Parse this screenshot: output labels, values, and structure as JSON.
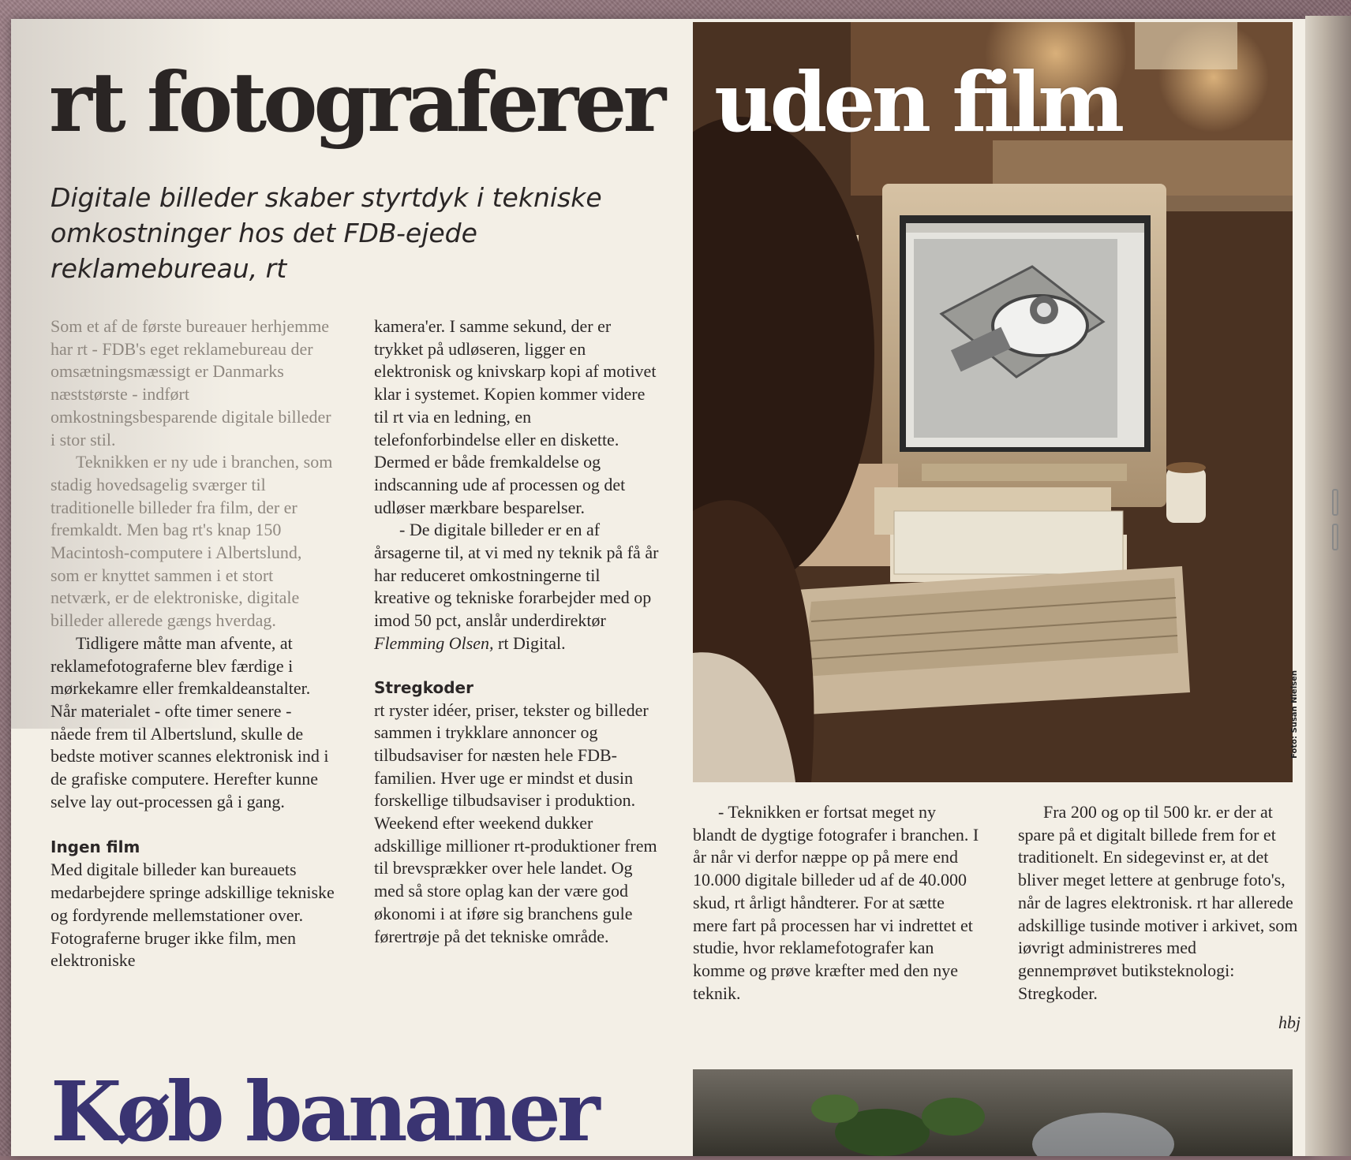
{
  "article": {
    "headline_dark": "rt fotograferer",
    "headline_light": "uden film",
    "subtitle": "Digitale billeder skaber styrtdyk i tekniske omkostninger hos det FDB-ejede reklamebureau, rt",
    "col1": {
      "p1": "Som et af de første bureauer herhjemme har rt - FDB's eget reklamebureau der omsætningsmæssigt er Danmarks næststørste - indført omkostningsbesparende digitale billeder i stor stil.",
      "p2": "Teknikken er ny ude i branchen, som stadig hovedsagelig sværger til traditionelle billeder fra film, der er fremkaldt. Men bag rt's knap 150 Macintosh-computere i Albertslund, som er knyttet sammen i et stort netværk, er de elektroniske, digitale billeder allerede gængs hverdag.",
      "p3": "Tidligere måtte man afvente, at reklamefotograferne blev færdige i mørkekamre eller fremkaldeanstalter. Når materialet - ofte timer senere - nåede frem til Albertslund, skulle de bedste motiver scannes elektronisk ind i de grafiske computere. Herefter kunne selve lay out-processen gå i gang.",
      "heading": "Ingen film",
      "p4": "Med digitale billeder kan bureauets medarbejdere springe adskillige tekniske og fordyrende mellemstationer over. Fotograferne bruger ikke film, men elektroniske"
    },
    "col2": {
      "p1": "kamera'er. I samme sekund, der er trykket på udløseren, ligger en elektronisk og knivskarp kopi af motivet klar i systemet. Kopien kommer videre til rt via en ledning, en telefonforbindelse eller en diskette. Dermed er både fremkaldelse og indscanning ude af processen og det udløser mærkbare besparelser.",
      "p2_before": "- De digitale billeder er en af årsagerne til, at vi med ny teknik på få år har reduceret omkostningerne til kreative og tekniske forarbejder med op imod 50 pct, anslår underdirektør ",
      "p2_name": "Flemming Olsen,",
      "p2_after": " rt Digital.",
      "heading": "Stregkoder",
      "p3": "rt ryster idéer, priser, tekster og billeder sammen i trykklare annoncer og tilbudsaviser for næsten hele FDB-familien. Hver uge er mindst et dusin forskellige tilbudsaviser i produktion. Weekend efter weekend dukker adskillige millioner rt-produktioner frem til brevsprækker over hele landet. Og med så store oplag kan der være god økonomi i at iføre sig branchens gule førertrøje på det tekniske område."
    },
    "col3": {
      "p1": "- Teknikken er fortsat meget ny blandt de dygtige fotografer i branchen. I år når vi derfor næppe op på mere end 10.000 digitale billeder ud af de 40.000 skud, rt årligt håndterer. For at sætte mere fart på processen har vi indrettet et studie, hvor reklamefotografer kan komme og prøve kræfter med den nye teknik."
    },
    "col4": {
      "p1": "Fra 200 og op til 500 kr. er der at spare på et digitalt billede frem for et traditionelt. En sidegevinst er, at det bliver meget lettere at genbruge foto's, når de lagres elektronisk. rt har allerede adskillige tusinde motiver i arkivet, som iøvrigt administreres med gennemprøvet butiksteknologi: Stregkoder."
    },
    "byline": "hbj",
    "photo_credit": "Foto: Susan Nielsen"
  },
  "next_article": {
    "headline": "Køb bananer"
  },
  "colors": {
    "paper": "#f3efe6",
    "ink": "#2a2524",
    "next_headline": "#3a3472"
  }
}
